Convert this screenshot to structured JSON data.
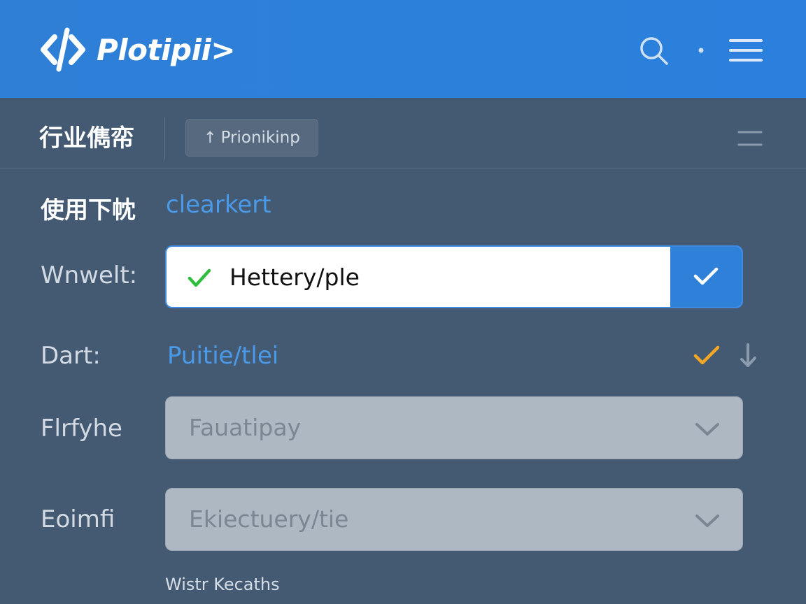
{
  "app": {
    "name": "Plotipii>",
    "logo_icon": "code-brackets-icon",
    "header_icons": [
      "search-icon",
      "dot-icon",
      "hamburger-menu-icon"
    ]
  },
  "toolbar": {
    "title": "行业儁帟",
    "priority_chip": {
      "icon": "arrow-up-icon",
      "label": "Prionikinp"
    },
    "menu_icon": "menu-lines-icon"
  },
  "form": {
    "usage_label": "使用下帎",
    "usage_value": "clearkert",
    "wnwelt": {
      "label": "Wnwelt:",
      "value": "Hettery/ple",
      "state": "valid"
    },
    "dart": {
      "label": "Dart:",
      "value": "Puitie/tlei"
    },
    "flrfyhe": {
      "label": "Flrfyhe",
      "placeholder": "Fauatipay"
    },
    "eoimfi": {
      "label": "Eoimfi",
      "placeholder": "Ekiectuery/tie"
    }
  },
  "footer": {
    "note": "Wistr Kecaths"
  },
  "colors": {
    "header_bg": "#2a80dc",
    "page_bg": "#435a72",
    "accent_blue": "#4a9ae9",
    "check_green": "#2ebd3c",
    "check_orange": "#f5a623",
    "disabled_field": "#aeb8c3"
  }
}
